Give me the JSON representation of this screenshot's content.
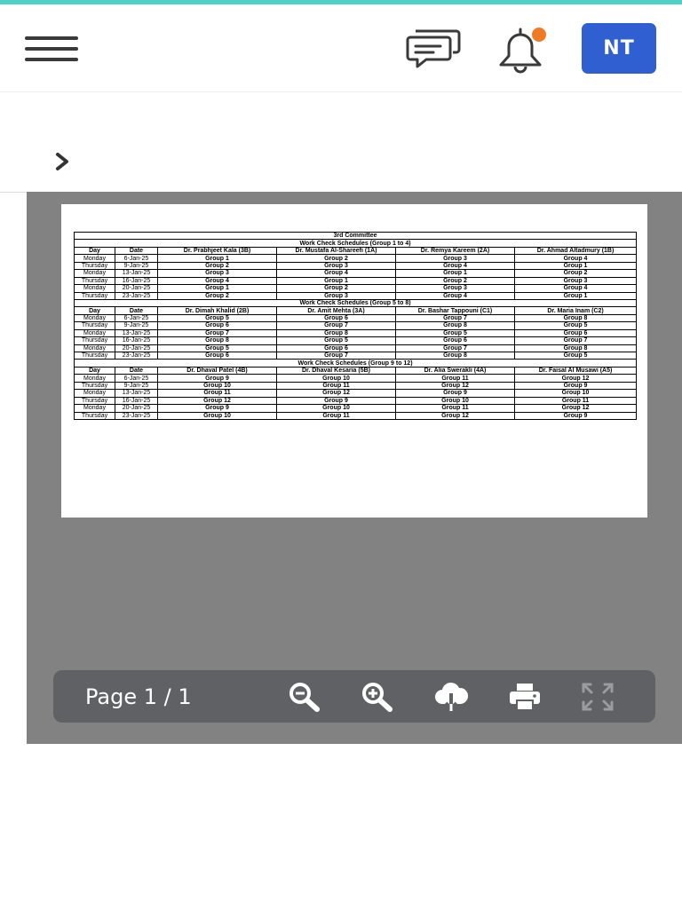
{
  "header": {
    "avatar_initials": "NT",
    "notification_dot_color": "#f07b24",
    "accent_color": "#4fd1c5",
    "avatar_color": "#2f5fd0",
    "icons": [
      "menu-icon",
      "chat-icon",
      "bell-icon"
    ]
  },
  "breadcrumb": {
    "icon": "chevron-right-icon"
  },
  "document": {
    "title": "3rd Committee",
    "sections": [
      {
        "heading": "Work Check Schedules (Group 1 to 4)",
        "columns": [
          "Day",
          "Date",
          "Dr. Prabhjeet Kala (3B)",
          "Dr. Mustafa Al-Shareefi (1A)",
          "Dr. Remya Kareem (2A)",
          "Dr. Ahmad Altadmury (1B)"
        ],
        "rows": [
          [
            "Monday",
            "6-Jan-25",
            "Group 1",
            "Group 2",
            "Group 3",
            "Group 4"
          ],
          [
            "Thursday",
            "9-Jan-25",
            "Group 2",
            "Group 3",
            "Group 4",
            "Group 1"
          ],
          [
            "Monday",
            "13-Jan-25",
            "Group 3",
            "Group 4",
            "Group 1",
            "Group 2"
          ],
          [
            "Thursday",
            "16-Jan-25",
            "Group 4",
            "Group 1",
            "Group 2",
            "Group 3"
          ],
          [
            "Monday",
            "20-Jan-25",
            "Group 1",
            "Group 2",
            "Group 3",
            "Group 4"
          ],
          [
            "Thursday",
            "23-Jan-25",
            "Group 2",
            "Group 3",
            "Group 4",
            "Group 1"
          ]
        ]
      },
      {
        "heading": "Work Check Schedules (Group 5 to 8)",
        "columns": [
          "Day",
          "Date",
          "Dr. Dimah Khalid (2B)",
          "Dr. Amit Mehta (3A)",
          "Dr. Bashar Tappouni (C1)",
          "Dr. Maria Inam (C2)"
        ],
        "rows": [
          [
            "Monday",
            "6-Jan-25",
            "Group 5",
            "Group 6",
            "Group 7",
            "Group 8"
          ],
          [
            "Thursday",
            "9-Jan-25",
            "Group 6",
            "Group 7",
            "Group 8",
            "Group 5"
          ],
          [
            "Monday",
            "13-Jan-25",
            "Group 7",
            "Group 8",
            "Group 5",
            "Group 6"
          ],
          [
            "Thursday",
            "16-Jan-25",
            "Group 8",
            "Group 5",
            "Group 6",
            "Group 7"
          ],
          [
            "Monday",
            "20-Jan-25",
            "Group 5",
            "Group 6",
            "Group 7",
            "Group 8"
          ],
          [
            "Thursday",
            "23-Jan-25",
            "Group 6",
            "Group 7",
            "Group 8",
            "Group 5"
          ]
        ]
      },
      {
        "heading": "Work Check Schedules (Group 9 to 12)",
        "columns": [
          "Day",
          "Date",
          "Dr. Dhaval Patel (4B)",
          "Dr. Dhaval Kesaria (5B)",
          "Dr. Alia Swerakli (4A)",
          "Dr. Faisal Al Musawi (A5)"
        ],
        "rows": [
          [
            "Monday",
            "6-Jan-25",
            "Group 9",
            "Group 10",
            "Group 11",
            "Group 12"
          ],
          [
            "Thursday",
            "9-Jan-25",
            "Group 10",
            "Group 11",
            "Group 12",
            "Group 9"
          ],
          [
            "Monday",
            "13-Jan-25",
            "Group 11",
            "Group 12",
            "Group 9",
            "Group 10"
          ],
          [
            "Thursday",
            "16-Jan-25",
            "Group 12",
            "Group 9",
            "Group 10",
            "Group 11"
          ],
          [
            "Monday",
            "20-Jan-25",
            "Group 9",
            "Group 10",
            "Group 11",
            "Group 12"
          ],
          [
            "Thursday",
            "23-Jan-25",
            "Group 10",
            "Group 11",
            "Group 12",
            "Group 9"
          ]
        ]
      }
    ]
  },
  "toolbar": {
    "page_label": "Page 1 / 1",
    "buttons": [
      "zoom-out-icon",
      "zoom-in-icon",
      "download-icon",
      "print-icon",
      "fullscreen-icon"
    ]
  }
}
